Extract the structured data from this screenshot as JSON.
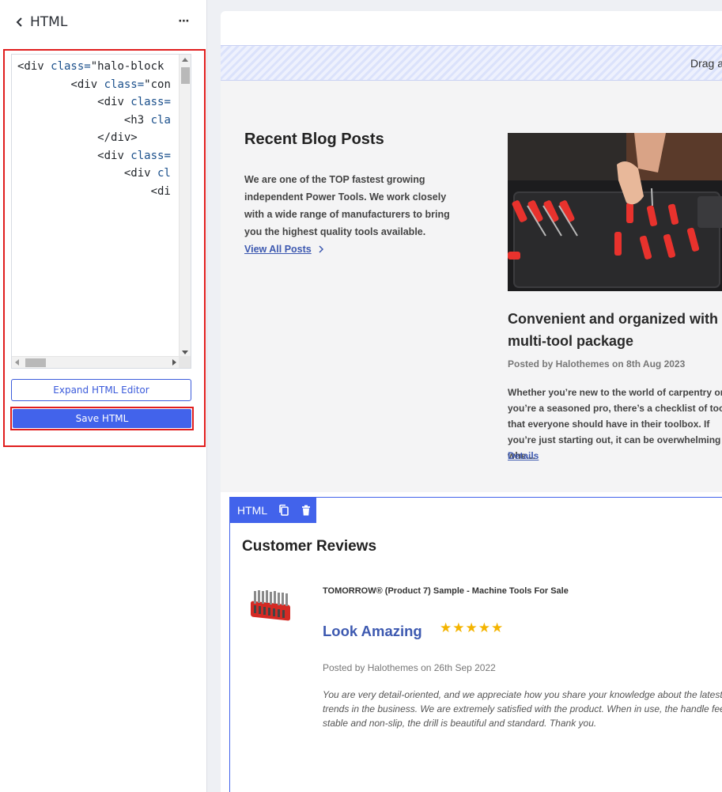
{
  "panel": {
    "title": "HTML",
    "more_label": "⋯",
    "code_lines": [
      {
        "indent": "",
        "tag": "<div",
        "attr": " class=",
        "value": "\"halo-block"
      },
      {
        "indent": "        ",
        "tag": "<div",
        "attr": " class=",
        "value": "\"con"
      },
      {
        "indent": "            ",
        "tag": "<div",
        "attr": " class=",
        "value": ""
      },
      {
        "indent": "                ",
        "tag": "<h3",
        "attr": " cla",
        "value": ""
      },
      {
        "indent": "            ",
        "tag": "</div>",
        "attr": "",
        "value": ""
      },
      {
        "indent": "            ",
        "tag": "<div",
        "attr": " class=",
        "value": ""
      },
      {
        "indent": "                ",
        "tag": "<div",
        "attr": " cl",
        "value": ""
      },
      {
        "indent": "                    ",
        "tag": "<di",
        "attr": "",
        "value": ""
      }
    ],
    "expand_label": "Expand HTML Editor",
    "save_label": "Save HTML"
  },
  "preview": {
    "drag_text": "Drag a",
    "blog": {
      "heading": "Recent Blog Posts",
      "description": "We are one of the TOP fastest growing independent Power Tools. We work closely with a wide range of manufacturers to bring you the highest quality tools available.",
      "view_all": "View All Posts",
      "post": {
        "title": "Convenient and organized with multi-tool package",
        "meta": "Posted by Halothemes on 8th Aug 2023",
        "excerpt": "Whether you’re new to the world of carpentry or you’re a seasoned pro, there’s a checklist of tools that everyone should have in their toolbox. If you’re just starting out, it can be overwhelming whe…",
        "details": "Details"
      }
    },
    "reviews": {
      "toolbar_label": "HTML",
      "heading": "Customer Reviews",
      "product": "TOMORROW®  (Product 7) Sample - Machine Tools For Sale",
      "title": "Look Amazing",
      "stars": "★★★★★",
      "rating": 5,
      "meta": "Posted by Halothemes on 26th Sep 2022",
      "body": "You are very detail-oriented, and we appreciate how you share your knowledge about the latest trends in the business. We are extremely satisfied with the product. When in use, the handle feels stable and non-slip, the drill is beautiful and standard. Thank you."
    }
  },
  "colors": {
    "accent": "#4263eb",
    "link": "#3d59b0",
    "highlight": "#e01e1e",
    "star": "#f4b400"
  }
}
